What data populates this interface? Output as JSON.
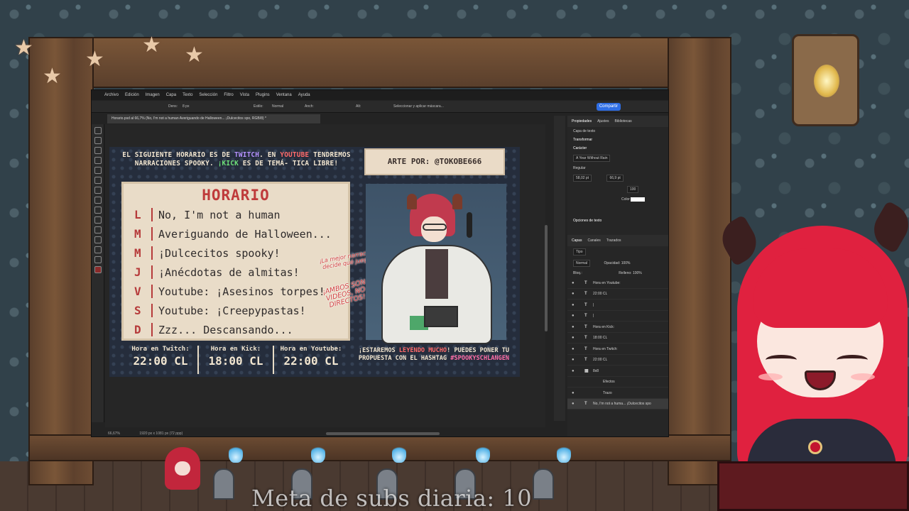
{
  "photoshop": {
    "menu": [
      "Archivo",
      "Edición",
      "Imagen",
      "Capa",
      "Texto",
      "Selección",
      "Filtro",
      "Vista",
      "Plugins",
      "Ventana",
      "Ayuda"
    ],
    "options": {
      "density": "Dens:",
      "size": "8 px",
      "style_label": "Estilo:",
      "style_value": "Normal",
      "width": "Anch:",
      "height": "Alt:",
      "select_mask": "Seleccionar y aplicar máscara...",
      "share": "Compartir"
    },
    "doc_tab": "Horario.psd al 66,7% (No, I'm not a human Averiguando de Halloween... ¡Dulcecitos spo, RGB/8) *",
    "status": {
      "zoom": "66,67%",
      "dims": "1920 px x 1081 px (72 ppp)"
    },
    "panel": {
      "tabs": [
        "Propiedades",
        "Ajustes",
        "Bibliotecas"
      ],
      "layer_type": "Capa de texto",
      "transform": "Transformar",
      "character": "Carácter",
      "font": "A Year Without Rain",
      "font_style": "Regular",
      "font_size": "58,02 pt",
      "leading": "66,9 pt",
      "tracking": "100",
      "color_label": "Color",
      "text_options": "Opciones de texto",
      "layers_tabs": [
        "Capas",
        "Canales",
        "Trazados"
      ],
      "filter": "Tipo",
      "blend": "Normal",
      "opacity_label": "Opacidad:",
      "opacity": "100%",
      "lock_label": "Bloq.:",
      "fill_label": "Relleno:",
      "fill": "100%",
      "layers": [
        {
          "kind": "T",
          "name": "Hora en Youtube:"
        },
        {
          "kind": "T",
          "name": "22:00 CL"
        },
        {
          "kind": "T",
          "name": "|"
        },
        {
          "kind": "T",
          "name": "|"
        },
        {
          "kind": "T",
          "name": "Hora en Kick:"
        },
        {
          "kind": "T",
          "name": "18:00 CL"
        },
        {
          "kind": "T",
          "name": "Hora en Twitch:"
        },
        {
          "kind": "T",
          "name": "22:00 CL"
        },
        {
          "kind": "▦",
          "name": "8x8"
        },
        {
          "kind": "",
          "name": "Efectos"
        },
        {
          "kind": "",
          "name": "Trazo"
        },
        {
          "kind": "T",
          "name": "No, I'm not a huma... ¡Dulcecitos spo"
        }
      ]
    }
  },
  "artwork": {
    "intro": {
      "p1": "EL SIGUIENTE HORARIO ES DE ",
      "twitch": "TWITCH",
      "p2": ". EN ",
      "youtube": "YOUTUBE",
      "p3": " TENDREMOS NARRACIONES SPOOKY. ",
      "kick": "¡KICK",
      "p4": " ES DE TEMÁ- TICA LIBRE!"
    },
    "credit": "ARTE POR: @TOKOBE666",
    "schedule_title": "HORARIO",
    "days": [
      {
        "letter": "L",
        "text": "No, I'm not a human"
      },
      {
        "letter": "M",
        "text": "Averiguando de Halloween..."
      },
      {
        "letter": "M",
        "text": "¡Dulcecitos spooky!"
      },
      {
        "letter": "J",
        "text": "¡Anécdotas de almitas!"
      },
      {
        "letter": "V",
        "text": "Youtube: ¡Asesinos torpes!"
      },
      {
        "letter": "S",
        "text": "Youtube: ¡Creepypastas!"
      },
      {
        "letter": "D",
        "text": "Zzz... Descansando..."
      }
    ],
    "note1": "¡La mejor narración decide qué juego!",
    "note2": "¡AMBOS SON VIDEOS, NO DIRECTOS!",
    "times": [
      {
        "label": "Hora en Twitch:",
        "value": "22:00 CL"
      },
      {
        "label": "Hora en Kick:",
        "value": "18:00 CL"
      },
      {
        "label": "Hora en Youtube:",
        "value": "22:00 CL"
      }
    ],
    "outro": {
      "p1": "¡ESTAREMOS ",
      "hl": "LEYENDO MUCHO",
      "p2": "! PUEDES PONER TU PROPUESTA CON EL HASHTAG ",
      "tag": "#SPOOKYSCHLANGEN"
    }
  },
  "overlay": {
    "subs_goal": "Meta de subs diaria: 10"
  },
  "colors": {
    "accent": "#2f6ee5",
    "schedule_red": "#bf3b3b",
    "hair": "#e0213f"
  }
}
